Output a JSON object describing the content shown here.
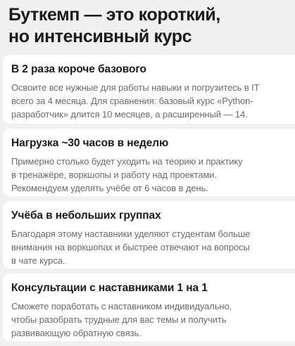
{
  "headline": {
    "line1": "Буткемп — это короткий,",
    "line2": "но интенсивный курс"
  },
  "cards": [
    {
      "title": "В 2 раза короче базового",
      "lines": [
        "Освоите все нужные для работы навыки и погрузитесь в IT",
        "всего за 4 месяца. Для сравнения: базовый курс «Python-",
        "разработчик» длится 10 месяцев, а расширенный — 14."
      ]
    },
    {
      "title": "Нагрузка ~30 часов в неделю",
      "lines": [
        "Примерно столько будет уходить на теорию и практику",
        "в тренажёре, воркшопы и работу над проектами.",
        "Рекомендуем уделять учёбе от 6 часов в день."
      ]
    },
    {
      "title": "Учёба в небольших группах",
      "lines": [
        "Благодаря этому наставники уделяют студентам больше",
        "внимания на воркшопах и быстрее отвечают на вопросы",
        "в чате курса."
      ]
    },
    {
      "title": "Консультации с наставниками 1 на 1",
      "lines": [
        "Сможете поработать с наставником индивидуально,",
        "чтобы разобрать трудные для вас темы и получить",
        "развивающую обратную связь."
      ]
    }
  ]
}
